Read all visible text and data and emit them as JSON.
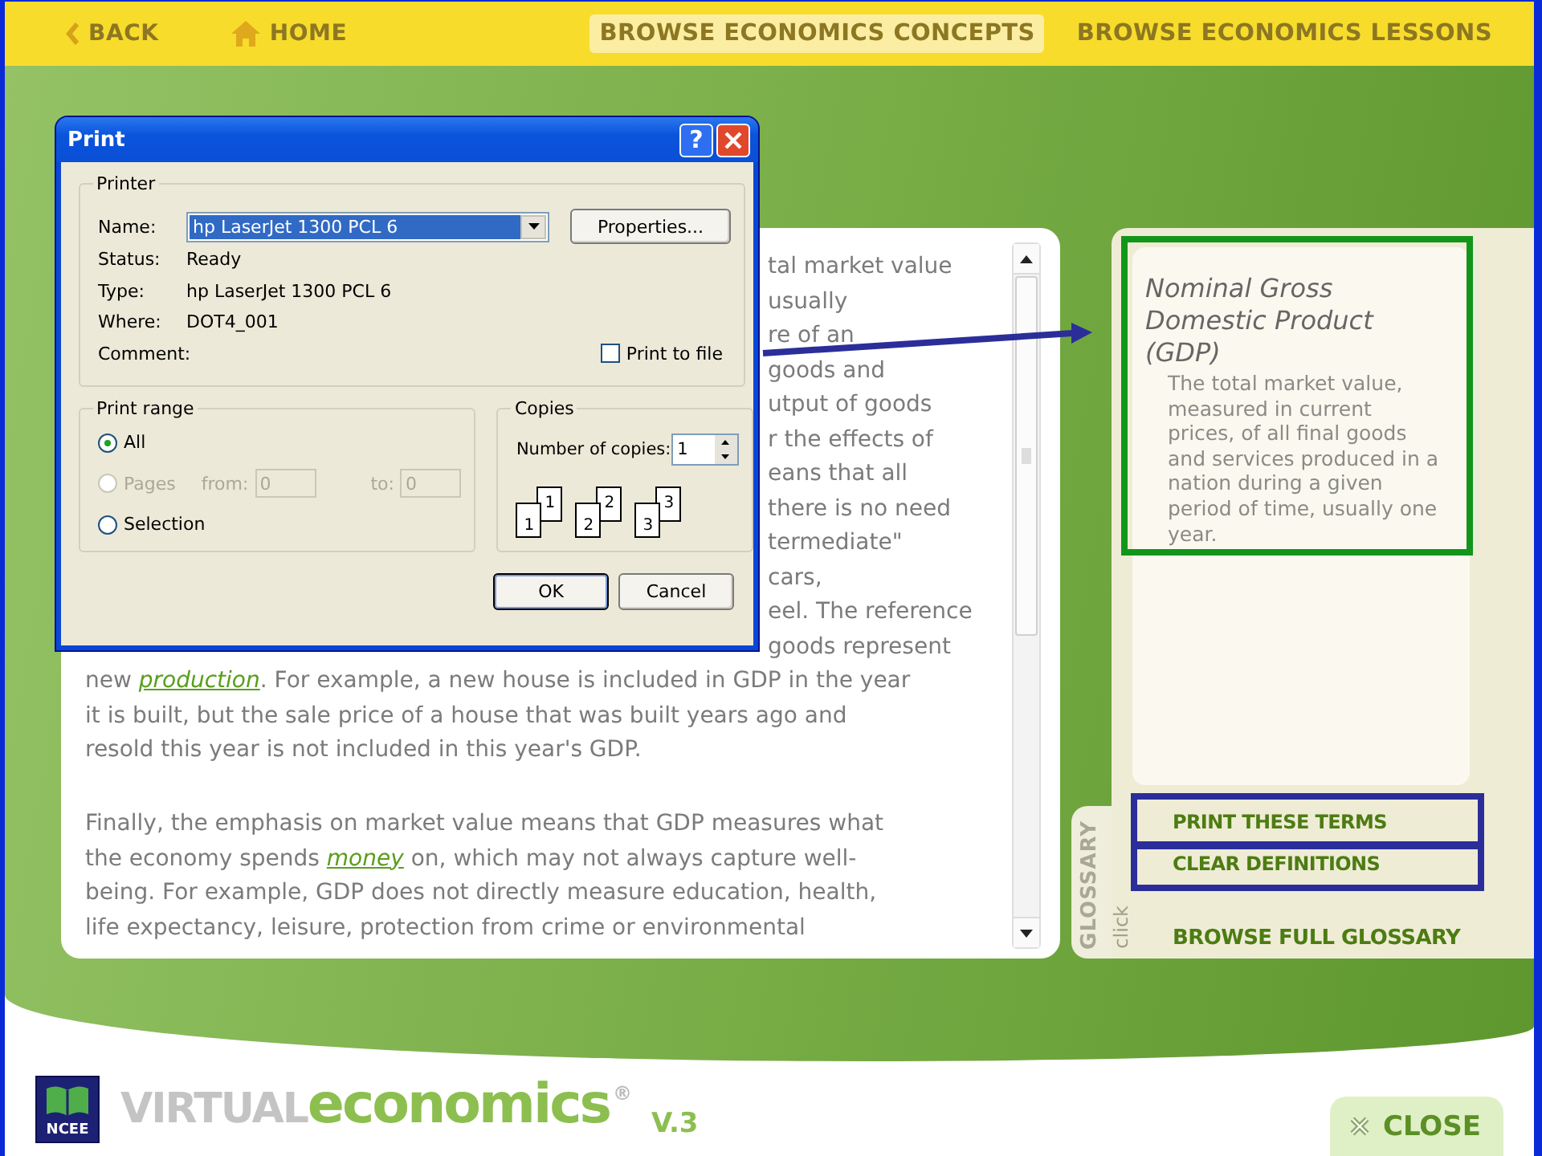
{
  "nav": {
    "back": "BACK",
    "home": "HOME",
    "tabs": [
      {
        "label": "BROWSE ECONOMICS CONCEPTS",
        "selected": true
      },
      {
        "label": "BROWSE ECONOMICS LESSONS",
        "selected": false
      }
    ]
  },
  "article": {
    "paragraphs": [
      {
        "lines": [
          {
            "kind": "fragment",
            "parts": [
              {
                "kind": "text",
                "text": "tal market value"
              }
            ]
          },
          {
            "kind": "fragment",
            "parts": [
              {
                "kind": "text",
                "text": "usually"
              }
            ]
          },
          {
            "kind": "fragment",
            "parts": [
              {
                "kind": "text",
                "text": "re of an"
              }
            ]
          },
          {
            "kind": "fragment",
            "parts": [
              {
                "kind": "text",
                "text": "goods and"
              }
            ]
          },
          {
            "kind": "fragment",
            "parts": [
              {
                "kind": "text",
                "text": "utput of goods"
              }
            ]
          },
          {
            "kind": "fragment",
            "parts": [
              {
                "kind": "text",
                "text": "r the effects of"
              }
            ]
          },
          {
            "kind": "fragment",
            "parts": [
              {
                "kind": "text",
                "text": "eans that all"
              }
            ]
          },
          {
            "kind": "fragment",
            "parts": [
              {
                "kind": "text",
                "text": "there is no need"
              }
            ]
          },
          {
            "kind": "fragment",
            "parts": [
              {
                "kind": "text",
                "text": "termediate\""
              }
            ]
          },
          {
            "kind": "fragment",
            "parts": [
              {
                "kind": "text",
                "text": "cars,"
              }
            ]
          },
          {
            "kind": "fragment",
            "parts": [
              {
                "kind": "text",
                "text": "eel. The reference"
              }
            ]
          },
          {
            "kind": "fragment",
            "parts": [
              {
                "kind": "text",
                "text": "goods represent"
              }
            ]
          },
          {
            "kind": "full",
            "parts": [
              {
                "kind": "text",
                "text": "new "
              },
              {
                "kind": "link",
                "text": "production"
              },
              {
                "kind": "text",
                "text": ". For example, a new house is included in GDP in the year"
              }
            ]
          },
          {
            "kind": "full",
            "parts": [
              {
                "kind": "text",
                "text": "it is built, but the sale price of a house that was built years ago and"
              }
            ]
          },
          {
            "kind": "full",
            "parts": [
              {
                "kind": "text",
                "text": "resold this year is not included in this year's GDP."
              }
            ]
          }
        ]
      },
      {
        "lines": [
          {
            "kind": "full",
            "parts": [
              {
                "kind": "text",
                "text": "Finally, the emphasis on market value means that GDP measures what"
              }
            ]
          },
          {
            "kind": "full",
            "parts": [
              {
                "kind": "text",
                "text": "the economy spends "
              },
              {
                "kind": "link",
                "text": "money"
              },
              {
                "kind": "text",
                "text": " on, which may not always capture well-"
              }
            ]
          },
          {
            "kind": "full",
            "parts": [
              {
                "kind": "text",
                "text": "being. For example, GDP does not directly measure education, health,"
              }
            ]
          },
          {
            "kind": "full",
            "parts": [
              {
                "kind": "text",
                "text": "life expectancy, leisure, protection from crime or environmental"
              }
            ]
          }
        ]
      }
    ]
  },
  "glossary": {
    "tab_label": "GLOSSARY",
    "tab_hint": "click",
    "terms": [
      {
        "term": "Nominal Gross Domestic Product (GDP)",
        "definition": "The total market value, measured in current prices, of all final goods and services produced in a nation during a given period of time, usually one year."
      }
    ],
    "actions": [
      "PRINT THESE TERMS",
      "CLEAR DEFINITIONS"
    ],
    "browse_link": "BROWSE FULL GLOSSARY"
  },
  "footer": {
    "badge": "NCEE",
    "wordmark": [
      "VIRTUAL",
      "economics",
      "®"
    ],
    "version": "V.3",
    "close": "CLOSE"
  },
  "print_dialog": {
    "title": "Print",
    "help_button": "?",
    "printer": {
      "legend": "Printer",
      "name_label": "Name:",
      "name_value": "hp LaserJet 1300 PCL 6",
      "properties": "Properties...",
      "info": [
        {
          "label": "Status:",
          "value": "Ready"
        },
        {
          "label": "Type:",
          "value": "hp LaserJet 1300 PCL 6"
        },
        {
          "label": "Where:",
          "value": "DOT4_001"
        },
        {
          "label": "Comment:"
        }
      ],
      "print_to_file": {
        "label": "Print to file",
        "checked": false
      }
    },
    "print_range": {
      "legend": "Print range",
      "options": [
        {
          "label": "All",
          "selected": true,
          "disabled": false
        },
        {
          "label": "Pages",
          "selected": false,
          "disabled": true
        },
        {
          "label": "Selection",
          "selected": false,
          "disabled": false
        }
      ],
      "from": {
        "label": "from:",
        "value": "0"
      },
      "to": {
        "label": "to:",
        "value": "0"
      }
    },
    "copies": {
      "legend": "Copies",
      "label": "Number of copies:",
      "value": "1",
      "collate_pages": [
        "1",
        "1",
        "2",
        "2",
        "3",
        "3"
      ]
    },
    "buttons": [
      "OK",
      "Cancel"
    ]
  }
}
